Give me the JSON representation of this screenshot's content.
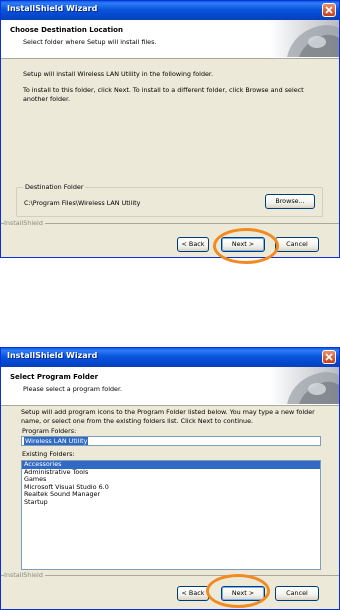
{
  "window1": {
    "title": "InstallShield Wizard",
    "header_title": "Choose Destination Location",
    "header_subtitle": "Select folder where Setup will install files.",
    "body_line1": "Setup will install Wireless LAN Utility in the following folder.",
    "body_line2": "To install to this folder, click Next. To install to a different folder, click Browse and select another folder.",
    "group_label": "Destination Folder",
    "destination_path": "C:\\Program Files\\Wireless LAN Utility",
    "browse_label": "Browse...",
    "installshield_label": "InstallShield",
    "back_label": "< Back",
    "next_label": "Next >",
    "cancel_label": "Cancel"
  },
  "window2": {
    "title": "InstallShield Wizard",
    "header_title": "Select Program Folder",
    "header_subtitle": "Please select a program folder.",
    "body_text": "Setup will add program icons to the Program Folder listed below. You may type a new folder name, or select one from the existing folders list. Click Next to continue.",
    "program_folders_label": "Program Folders:",
    "program_folder_value": "Wireless LAN Utility",
    "existing_folders_label": "Existing Folders:",
    "existing_folders": [
      "Accessories",
      "Administrative Tools",
      "Games",
      "Microsoft Visual Studio 6.0",
      "Realtek Sound Manager",
      "Startup"
    ],
    "installshield_label": "InstallShield",
    "back_label": "< Back",
    "next_label": "Next >",
    "cancel_label": "Cancel"
  },
  "colors": {
    "titlebar": "#0855dd",
    "dialog_bg": "#ece9d8",
    "selection": "#316ac5",
    "highlight_ring": "#f28a22"
  }
}
